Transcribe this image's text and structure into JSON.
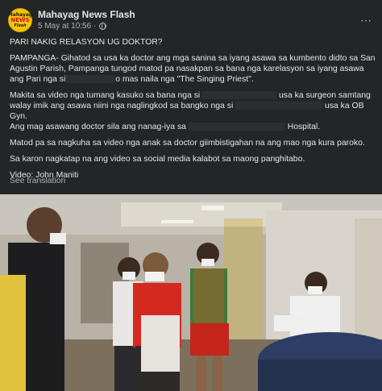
{
  "header": {
    "page_name": "Mahayag News Flash",
    "timestamp": "5 May at 10:56",
    "privacy_dot": "·",
    "more_icon": "⋯",
    "avatar_text": {
      "line1": "Mahayag",
      "line2": "NEWS",
      "line3": "Flash"
    }
  },
  "post": {
    "headline": "PARI NAKIG RELASYON UG DOKTOR?",
    "para1_line1": "PAMPANGA- Gihatod sa usa ka doctor ang mga sanina sa iyang asawa sa kumbento didto sa San",
    "para1_line2": "Agustin Parish, Pampanga tungod matod pa nasakpan sa bana nga karelasyon sa iyang asawa",
    "para1_line3a": "ang Pari nga si",
    "para1_line3b": "o mas naila nga \"The Singing Priest\".",
    "para2_line1a": "Makita sa video nga tumang kasuko sa bana nga si",
    "para2_line1b": "usa ka surgeon samtang",
    "para2_line2a": "walay imik ang asawa niini nga naglingkod sa bangko nga si",
    "para2_line2b": "usa ka OB",
    "para2_line3": "Gyn.",
    "para2_line4a": "Ang mag asawang doctor sila ang nanag-iya sa",
    "para2_line4b": "Hospital.",
    "para3": "Matod pa sa nagkuha sa video nga anak sa doctor giimbistigahan na ang mao nga kura paroko.",
    "para4": "Sa karon nagkatap na ang video sa social media kalabot sa maong panghitabo.",
    "credit": "Video: John Maniti",
    "see_translation": "See translation"
  },
  "colors": {
    "background": "#242526",
    "text_primary": "#e4e6eb",
    "text_secondary": "#b0b3b8",
    "avatar_bg": "#f5c400"
  }
}
